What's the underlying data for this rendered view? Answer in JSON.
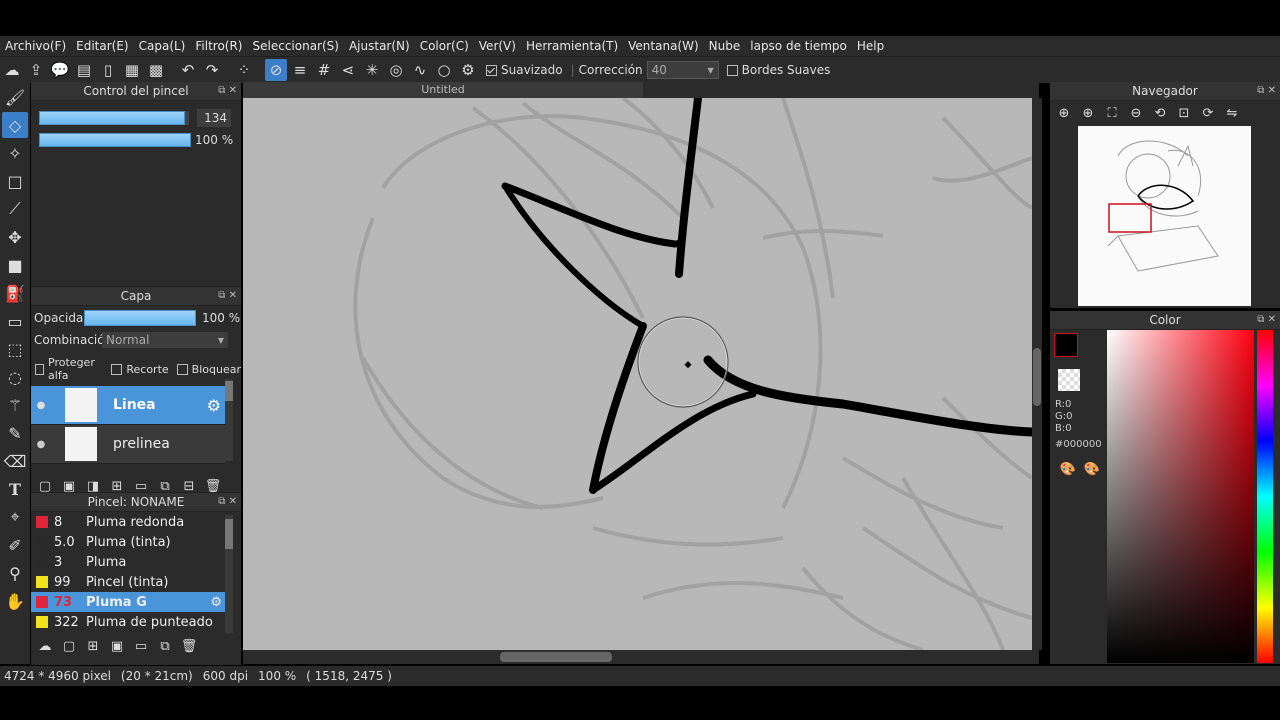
{
  "menu": [
    "Archivo(F)",
    "Editar(E)",
    "Capa(L)",
    "Filtro(R)",
    "Seleccionar(S)",
    "Ajustar(N)",
    "Color(C)",
    "Ver(V)",
    "Herramienta(T)",
    "Ventana(W)",
    "Nube",
    "lapso de tiempo",
    "Help"
  ],
  "toolbar": {
    "suavizado_label": "Suavizado",
    "correccion_label": "Corrección",
    "correccion_value": "40",
    "bordes_label": "Bordes Suaves"
  },
  "brush_control": {
    "title": "Control del pincel",
    "size": "134",
    "opacity": "100 %",
    "size_fraction": 0.96,
    "opacity_fraction": 1.0
  },
  "layer_panel": {
    "title": "Capa",
    "opacity_label": "Opacidad",
    "opacity_value": "100 %",
    "blend_label": "Combinación",
    "blend_value": "Normal",
    "protect_label": "Proteger alfa",
    "clip_label": "Recorte",
    "lock_label": "Bloquear",
    "layers": [
      {
        "name": "Linea",
        "selected": true
      },
      {
        "name": "prelinea",
        "selected": false
      }
    ]
  },
  "brush_panel": {
    "title": "Pincel: NONAME",
    "brushes": [
      {
        "size": "8",
        "name": "Pluma redonda",
        "color": "#e0243a"
      },
      {
        "size": "5.0",
        "name": "Pluma (tinta)",
        "color": "#2a2a2a"
      },
      {
        "size": "3",
        "name": "Pluma",
        "color": "#2a2a2a"
      },
      {
        "size": "99",
        "name": "Pincel (tinta)",
        "color": "#f2e21e"
      },
      {
        "size": "73",
        "name": "Pluma G",
        "color": "#e0243a"
      },
      {
        "size": "322",
        "name": "Pluma de punteado",
        "color": "#f2e21e"
      }
    ]
  },
  "canvas": {
    "title": "Untitled"
  },
  "navigator": {
    "title": "Navegador"
  },
  "color_panel": {
    "title": "Color",
    "r": "R:0",
    "g": "G:0",
    "b": "B:0",
    "hex": "#000000"
  },
  "status": {
    "pixels": "4724 * 4960 pixel",
    "size_cm": "(20 * 21cm)",
    "dpi": "600 dpi",
    "zoom": "100 %",
    "coords": "( 1518, 2475 )"
  },
  "colors": {
    "accent": "#3b7fc8",
    "panel": "#2b2b2b",
    "canvas": "#b8b8b8"
  }
}
